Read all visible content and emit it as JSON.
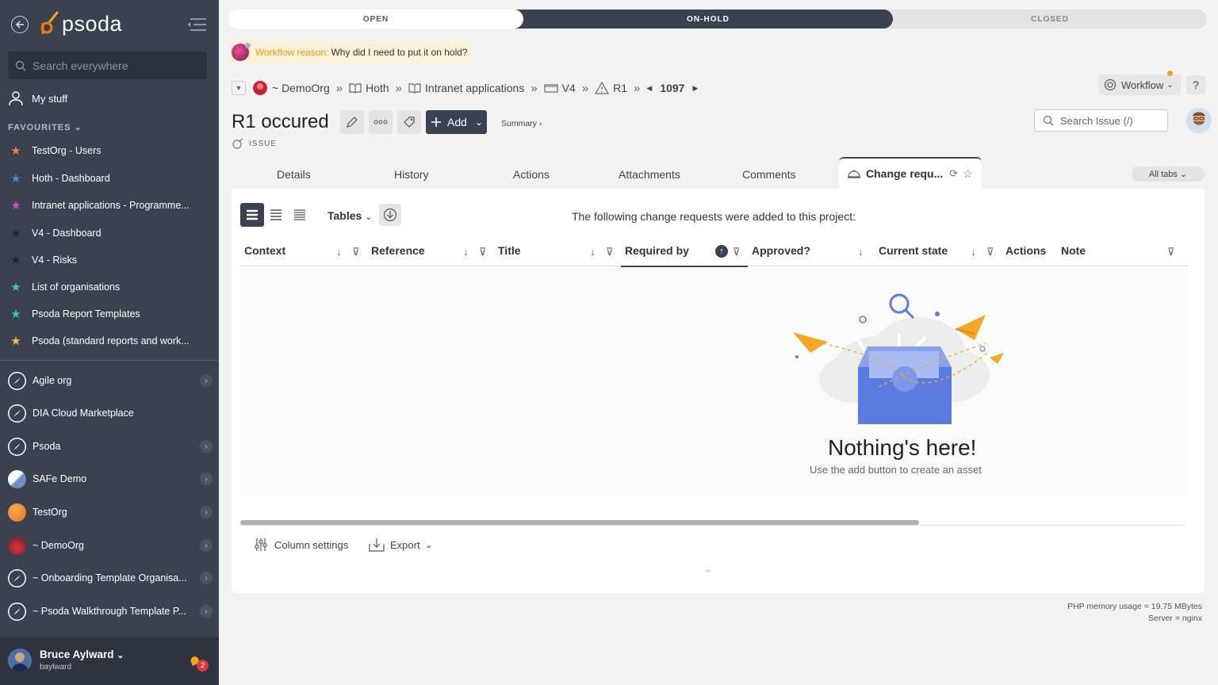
{
  "sidebar": {
    "logo": "psoda",
    "search_placeholder": "Search everywhere",
    "my_stuff": "My stuff",
    "favourites_heading": "FAVOURITES",
    "favourites": [
      {
        "label": "TestOrg - Users",
        "color": "#f0803c"
      },
      {
        "label": "Hoth - Dashboard",
        "color": "#3b8ee8"
      },
      {
        "label": "Intranet applications - Programme...",
        "color": "#d84bd0"
      },
      {
        "label": "V4 - Dashboard",
        "color": "#2a2c33"
      },
      {
        "label": "V4 - Risks",
        "color": "#2a2c33"
      },
      {
        "label": "List of organisations",
        "color": "#3cc0d8"
      },
      {
        "label": "Psoda Report Templates",
        "color": "#3cc0d8"
      },
      {
        "label": "Psoda (standard reports and work...",
        "color": "#e8c23c"
      }
    ],
    "organisations": [
      {
        "label": "Agile org",
        "has_children": true
      },
      {
        "label": "DIA Cloud Marketplace",
        "has_children": false
      },
      {
        "label": "Psoda",
        "has_children": true
      },
      {
        "label": "SAFe Demo",
        "has_children": true
      },
      {
        "label": "TestOrg",
        "has_children": true
      },
      {
        "label": "~ DemoOrg",
        "has_children": true
      },
      {
        "label": "~ Onboarding Template Organisa...",
        "has_children": true
      },
      {
        "label": "~ Psoda Walkthrough Template P...",
        "has_children": true
      }
    ],
    "user": {
      "name": "Bruce Aylward",
      "handle": "baylward",
      "notifications": "2"
    }
  },
  "workflow": {
    "stages": [
      "OPEN",
      "ON-HOLD",
      "CLOSED"
    ],
    "current_stage": "ON-HOLD",
    "reason_label": "Workflow reason:",
    "reason_text": "Why did I need to put it on hold?"
  },
  "breadcrumb": {
    "items": [
      "~ DemoOrg",
      "Hoth",
      "Intranet applications",
      "V4",
      "R1"
    ],
    "number": "1097"
  },
  "header": {
    "title": "R1 occured",
    "type": "ISSUE",
    "add_label": "Add",
    "summary_label": "Summary ›",
    "search_placeholder": "Search Issue (/)",
    "workflow_btn": "Workflow",
    "help": "?"
  },
  "tabs": {
    "items": [
      "Details",
      "History",
      "Actions",
      "Attachments",
      "Comments"
    ],
    "active": "Change requ...",
    "all_tabs": "All tabs"
  },
  "panel": {
    "view_label": "Tables",
    "info": "The following change requests were added to this project:",
    "columns": [
      "Context",
      "Reference",
      "Title",
      "Required by",
      "Approved?",
      "Current state",
      "Actions",
      "Note"
    ],
    "sorted_column": "Required by",
    "empty_title": "Nothing's here!",
    "empty_sub": "Use the add button to create an asset",
    "column_settings": "Column settings",
    "export": "Export"
  },
  "footer": {
    "memory": "PHP memory usage = 19.75 MBytes",
    "server": "Server = nginx"
  },
  "colors": {
    "sidebar_bg": "#3c4150",
    "accent_dark": "#3c4150",
    "warning": "#e59a16",
    "illustration_blue": "#5b7be0",
    "illustration_orange": "#f5a623"
  }
}
